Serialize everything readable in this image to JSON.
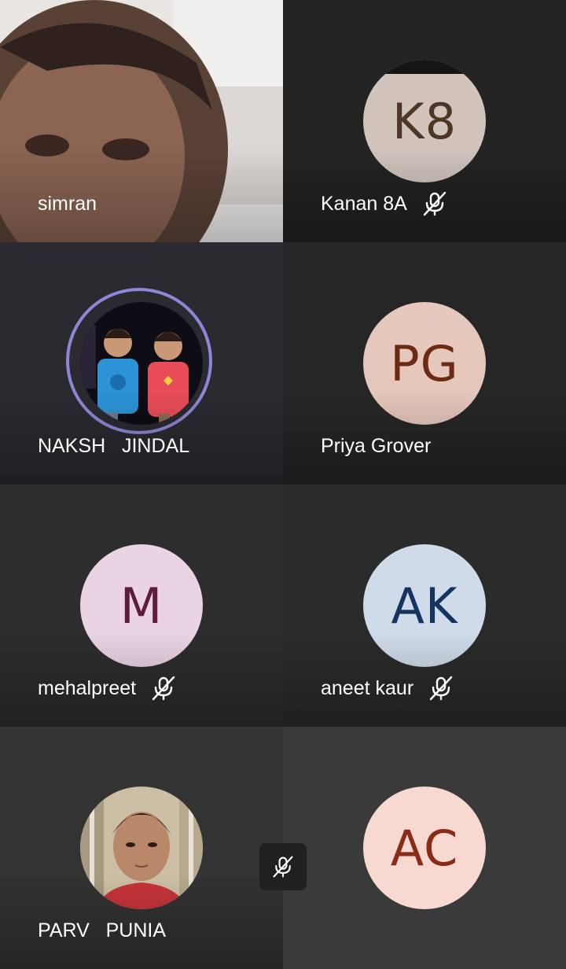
{
  "participants": [
    {
      "name": "simran",
      "type": "video",
      "muted": false
    },
    {
      "name": "Kanan 8A",
      "initials": "K8",
      "avatar_bg": "#d0c4bd",
      "initials_color": "#4d3527",
      "muted": true
    },
    {
      "name": "NAKSH   JINDAL",
      "type": "photo",
      "speaking": true,
      "muted": false
    },
    {
      "name": "Priya Grover",
      "initials": "PG",
      "avatar_bg": "#e5c7bb",
      "initials_color": "#6a2a14",
      "muted": false
    },
    {
      "name": "mehalpreet",
      "initials": "M",
      "avatar_bg": "#ead3e3",
      "initials_color": "#5b1c3d",
      "muted": true
    },
    {
      "name": "aneet kaur",
      "initials": "AK",
      "avatar_bg": "#cfdbe9",
      "initials_color": "#15335f",
      "muted": true
    },
    {
      "name": "PARV   PUNIA",
      "type": "photo",
      "muted": false
    },
    {
      "name": "",
      "initials": "AC",
      "avatar_bg": "#f7d9d2",
      "initials_color": "#8a2b18",
      "muted": false
    }
  ],
  "icons": {
    "mic_off": "mic-off-icon",
    "center_mute": "mic-off-icon"
  },
  "colors": {
    "speaking_ring": "#8d88d6",
    "label_text": "#ffffff"
  }
}
